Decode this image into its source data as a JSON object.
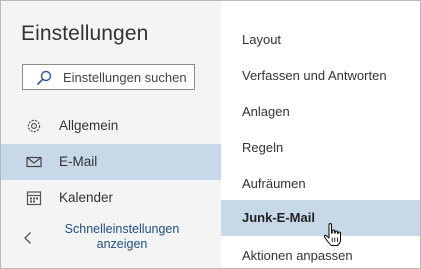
{
  "header": {
    "title": "Einstellungen"
  },
  "search": {
    "placeholder": "Einstellungen suchen",
    "icon": "search-icon"
  },
  "nav": {
    "items": [
      {
        "label": "Allgemein",
        "icon": "gear-icon",
        "active": false
      },
      {
        "label": "E-Mail",
        "icon": "mail-icon",
        "active": true
      },
      {
        "label": "Kalender",
        "icon": "calendar-icon",
        "active": false
      }
    ],
    "quick_settings": {
      "label": "Schnelleinstellungen anzeigen",
      "icon": "chevron-left-icon"
    }
  },
  "submenu": {
    "items": [
      {
        "label": "Layout",
        "active": false
      },
      {
        "label": "Verfassen und Antworten",
        "active": false
      },
      {
        "label": "Anlagen",
        "active": false
      },
      {
        "label": "Regeln",
        "active": false
      },
      {
        "label": "Aufräumen",
        "active": false
      },
      {
        "label": "Junk-E-Mail",
        "active": true
      },
      {
        "label": "Aktionen anpassen",
        "active": false
      }
    ]
  },
  "colors": {
    "accent_selected_bg": "#c7d8e8",
    "link_text": "#1f4f86",
    "pane_bg": "#f4f4f4"
  },
  "cursor": {
    "icon": "hand-pointer-icon"
  }
}
